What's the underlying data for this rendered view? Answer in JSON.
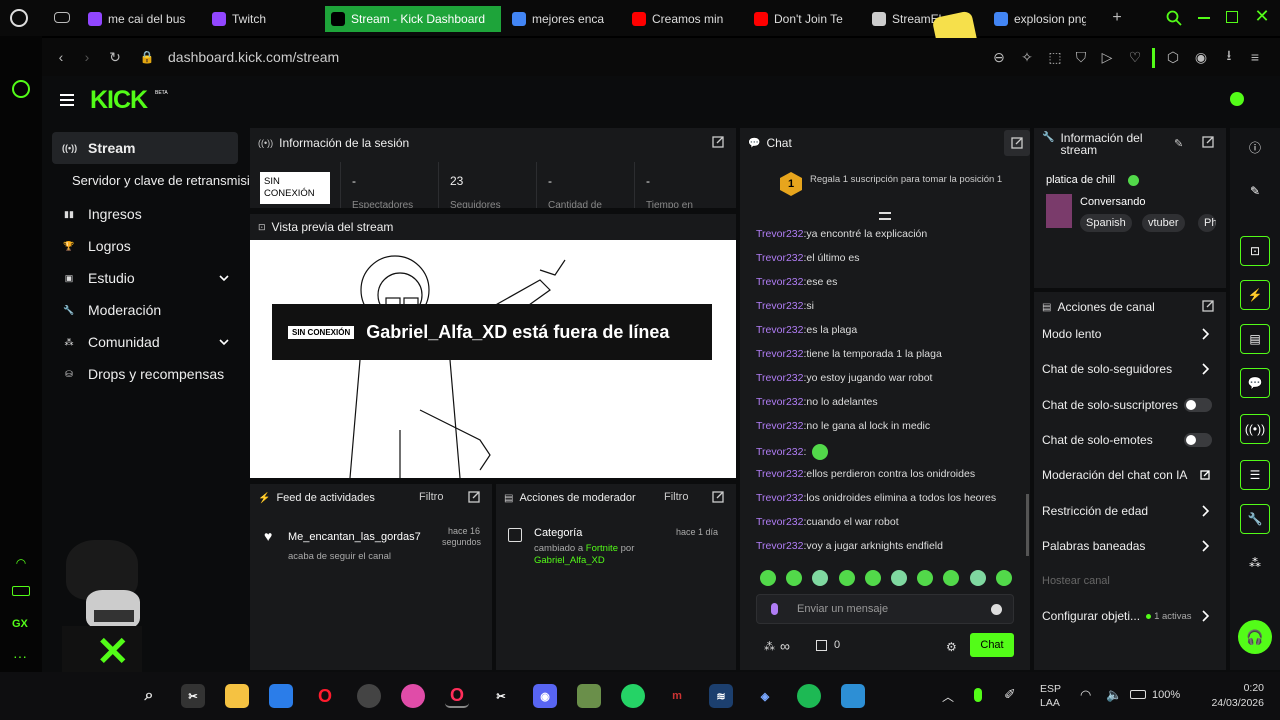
{
  "browser": {
    "tabs": [
      {
        "label": "me cai del bus",
        "icon": "twitch-icon",
        "color": "#9146ff"
      },
      {
        "label": "Twitch",
        "icon": "twitch-icon",
        "color": "#9146ff"
      },
      {
        "label": "Stream - Kick Dashboard",
        "icon": "kick-icon",
        "color": "#53fc18",
        "active": true
      },
      {
        "label": "mejores encar",
        "icon": "google-icon",
        "color": "#4285f4"
      },
      {
        "label": "Creamos min",
        "icon": "youtube-icon",
        "color": "#ff0000"
      },
      {
        "label": "Don't Join Te",
        "icon": "youtube-icon",
        "color": "#ff0000"
      },
      {
        "label": "StreamEle",
        "icon": "streamelements-icon",
        "color": "#cccccc"
      },
      {
        "label": "explosion png",
        "icon": "google-icon",
        "color": "#4285f4"
      }
    ],
    "url": "dashboard.kick.com/stream"
  },
  "kick": {
    "logo": "KICK",
    "beta": "BETA"
  },
  "sidebar": {
    "items": [
      {
        "label": "Stream",
        "icon": "broadcast-icon",
        "active": true
      },
      {
        "label": "Servidor y clave de retransmisión",
        "icon": "",
        "sub": true
      },
      {
        "label": "Ingresos",
        "icon": "chart-icon"
      },
      {
        "label": "Logros",
        "icon": "trophy-icon"
      },
      {
        "label": "Estudio",
        "icon": "studio-icon",
        "expandable": true
      },
      {
        "label": "Moderación",
        "icon": "wrench-icon"
      },
      {
        "label": "Comunidad",
        "icon": "community-icon",
        "expandable": true
      },
      {
        "label": "Drops y recompensas",
        "icon": "drops-icon"
      }
    ]
  },
  "session": {
    "title": "Información de la sesión",
    "status": "SIN CONEXIÓN",
    "stats": [
      {
        "value": "-",
        "label": "Espectadores"
      },
      {
        "value": "23",
        "label": "Seguidores"
      },
      {
        "value": "-",
        "label": "Cantidad de"
      },
      {
        "value": "-",
        "label": "Tiempo en"
      }
    ]
  },
  "preview": {
    "title": "Vista previa del stream",
    "badge": "SIN CONEXIÓN",
    "offline_text": "Gabriel_Alfa_XD está fuera de línea"
  },
  "activity": {
    "title": "Feed de actividades",
    "filter": "Filtro",
    "item": {
      "user": "Me_encantan_las_gordas7",
      "action": "acaba de seguir el canal",
      "time1": "hace 16",
      "time2": "segundos"
    }
  },
  "modactions": {
    "title": "Acciones de moderador",
    "filter": "Filtro",
    "item": {
      "title": "Categoría",
      "pre": "cambiado a",
      "game": "Fortnite",
      "by": "por",
      "user": "Gabriel_Alfa_XD",
      "time": "hace 1 día"
    }
  },
  "chat": {
    "title": "Chat",
    "gift_count": "1",
    "gift_text": "Regala 1 suscripción para tomar la posición 1",
    "messages": [
      {
        "user": "Trevor232",
        "text": "ya encontré la explicación"
      },
      {
        "user": "Trevor232",
        "text": "el último es"
      },
      {
        "user": "Trevor232",
        "text": "ese es"
      },
      {
        "user": "Trevor232",
        "text": "si"
      },
      {
        "user": "Trevor232",
        "text": "es la plaga"
      },
      {
        "user": "Trevor232",
        "text": "tiene la temporada 1 la plaga"
      },
      {
        "user": "Trevor232",
        "text": "yo estoy jugando war robot"
      },
      {
        "user": "Trevor232",
        "text": "no lo adelantes"
      },
      {
        "user": "Trevor232",
        "text": "no le gana al lock in medic"
      },
      {
        "user": "Trevor232",
        "text": "",
        "emote": true
      },
      {
        "user": "Trevor232",
        "text": "ellos perdieron contra los onidroides"
      },
      {
        "user": "Trevor232",
        "text": "los onidroides elimina a todos los heores"
      },
      {
        "user": "Trevor232",
        "text": "cuando el war robot"
      },
      {
        "user": "Trevor232",
        "text": "voy a jugar arknights endfield"
      }
    ],
    "placeholder": "Enviar un mensaje",
    "points": "∞",
    "gifts": "0",
    "send": "Chat"
  },
  "streaminfo": {
    "title": "Información del stream",
    "stream_title": "platica de chill",
    "category": "Conversando",
    "tags": [
      "Spanish",
      "vtuber",
      "Ph"
    ]
  },
  "channel_actions": {
    "title": "Acciones de canal",
    "items": [
      {
        "label": "Modo lento",
        "type": "arrow"
      },
      {
        "label": "Chat de solo-seguidores",
        "type": "arrow"
      },
      {
        "label": "Chat de solo-suscriptores",
        "type": "toggle"
      },
      {
        "label": "Chat de solo-emotes",
        "type": "toggle"
      },
      {
        "label": "Moderación del chat con IA",
        "type": "link"
      },
      {
        "label": "Restricción de edad",
        "type": "arrow"
      },
      {
        "label": "Palabras baneadas",
        "type": "arrow"
      },
      {
        "label": "Hostear canal",
        "type": "disabled"
      },
      {
        "label": "Configurar objeti...",
        "type": "arrow",
        "extra": "1 activas"
      }
    ]
  },
  "taskbar": {
    "lang1": "ESP",
    "lang2": "LAA",
    "battery": "100%",
    "time": "0:20",
    "date": "24/03/2026"
  },
  "colors": {
    "accent": "#53fc18",
    "username": "#b07df5",
    "panel": "#18191b"
  }
}
